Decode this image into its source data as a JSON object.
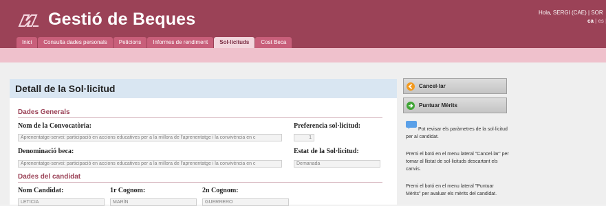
{
  "app": {
    "title": "Gestió de Beques"
  },
  "user": {
    "greeting": "Hola, SERGI (CAE) | SOR"
  },
  "languages": {
    "active": "ca",
    "separator": " | ",
    "other": "es |"
  },
  "tabs": [
    {
      "label": "Inici",
      "active": false
    },
    {
      "label": "Consulta dades personals",
      "active": false
    },
    {
      "label": "Peticions",
      "active": false
    },
    {
      "label": "Informes de rendiment",
      "active": false
    },
    {
      "label": "Sol·licituds",
      "active": true
    },
    {
      "label": "Cost Beca",
      "active": false
    }
  ],
  "detail": {
    "title": "Detall de la Sol·licitud",
    "general": {
      "heading": "Dades Generals",
      "convocatoria_label": "Nom de la Convocatòria:",
      "convocatoria_value": "Aprenentatge-servei: participació en accions educatives per a la millora de l'aprenentatge i la convivència en c",
      "preferencia_label": "Preferencia sol·licitud:",
      "preferencia_value": "1",
      "beca_label": "Denominació beca:",
      "beca_value": "Aprenentatge-servei: participació en accions educatives per a la millora de l'aprenentatge i la convivència en c",
      "estat_label": "Estat de la Sol·licitud:",
      "estat_value": "Demanada"
    },
    "candidat": {
      "heading": "Dades del candidat",
      "nom_label": "Nom Candidat:",
      "nom_value": "LETICIA",
      "cognom1_label": "1r Cognom:",
      "cognom1_value": "MARÍN",
      "cognom2_label": "2n Cognom:",
      "cognom2_value": "GUERRERO"
    }
  },
  "sidebar": {
    "cancel_label": "Cancel·lar",
    "merits_label": "Puntuar Mèrits",
    "help_1": "Pot revisar els paràmetres de la sol·licitud per al candidat.",
    "help_2": "Premi el botó en el menu lateral \"Cancel·lar\" per tornar al llistat de sol·licituds descartant els canvis.",
    "help_3": "Premi el botó en el menu lateral \"Puntuar Mèrits\" per avaluar els mèrits del candidat."
  },
  "colors": {
    "brand": "#9b4257",
    "tab": "#c85f7a",
    "subbar": "#efc1cc",
    "panel_title_bg": "#d9e6f2",
    "cancel_icon": "#f39a1e",
    "merits_icon": "#3fa535"
  },
  "icons": {
    "logo": "gencat-logo-icon",
    "cancel": "arrow-left-circle-icon",
    "merits": "arrow-right-circle-icon",
    "help": "speech-bubble-icon"
  }
}
